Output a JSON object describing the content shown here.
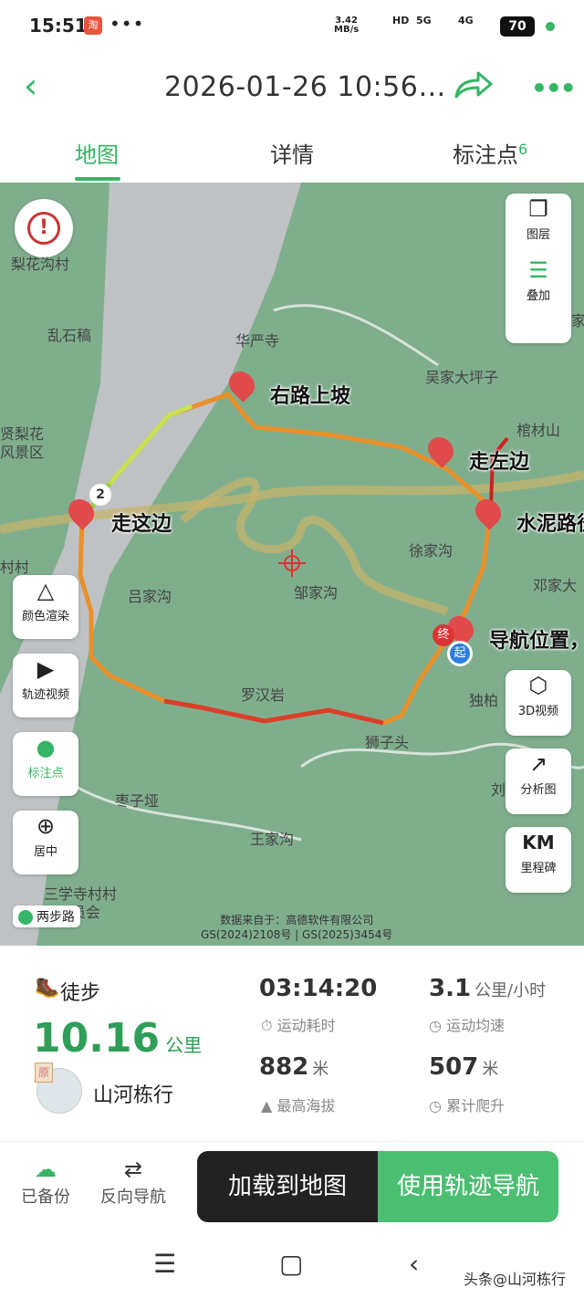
{
  "status": {
    "time": "15:51",
    "app_badge": "淘",
    "dots": "•••",
    "net_speed": "3.42",
    "net_unit": "MB/s",
    "hd": "HD",
    "s5g": "5G",
    "s4g": "4G",
    "battery": "70"
  },
  "header": {
    "title": "2026-01-26 10:56…"
  },
  "tabs": [
    {
      "label": "地图"
    },
    {
      "label": "详情"
    },
    {
      "label": "标注点",
      "count": "6"
    }
  ],
  "map": {
    "places": [
      "梨花沟村",
      "乱石稿",
      "华严寺",
      "吴家大坪子",
      "棺材山",
      "贤梨花",
      "风景区",
      "村村",
      "吕家沟",
      "邹家沟",
      "徐家沟",
      "邓家大",
      "罗汉岩",
      "独柏",
      "狮子头",
      "枣子垭",
      "王家沟",
      "三学寺村村",
      "员会",
      "家",
      "刘"
    ],
    "markers": [
      "右路上坡",
      "走左边",
      "走这边",
      "水泥路径",
      "导航位置，"
    ],
    "waypoint_number": "2",
    "start_label": "起",
    "end_label": "终",
    "badge": "两步路",
    "copyright": [
      "数据来自于：高德软件有限公司",
      "GS(2024)2108号 | GS(2025)3454号"
    ]
  },
  "map_buttons": {
    "layers": "图层",
    "overlay": "叠加",
    "color": "颜色渲染",
    "video": "轨迹视频",
    "marks": "标注点",
    "center": "居中",
    "v3d": "3D视频",
    "analysis": "分析图",
    "km_icon": "KM",
    "milestone": "里程碑"
  },
  "stats": {
    "activity": "徒步",
    "distance": "10.16",
    "distance_unit": "公里",
    "user_badge": "原",
    "user": "山河栋行",
    "duration": "03:14:20",
    "duration_label": "运动耗时",
    "speed": "3.1",
    "speed_unit": "公里/小时",
    "speed_label": "运动均速",
    "max_alt": "882",
    "max_alt_unit": "米",
    "max_alt_label": "最高海拔",
    "climb": "507",
    "climb_unit": "米",
    "climb_label": "累计爬升"
  },
  "bottom": {
    "backup": "已备份",
    "reverse": "反向导航",
    "load": "加载到地图",
    "navigate": "使用轨迹导航"
  },
  "watermark": "头条@山河栋行",
  "colors": {
    "accent": "#35b565",
    "map_bg": "#7fae8d"
  }
}
